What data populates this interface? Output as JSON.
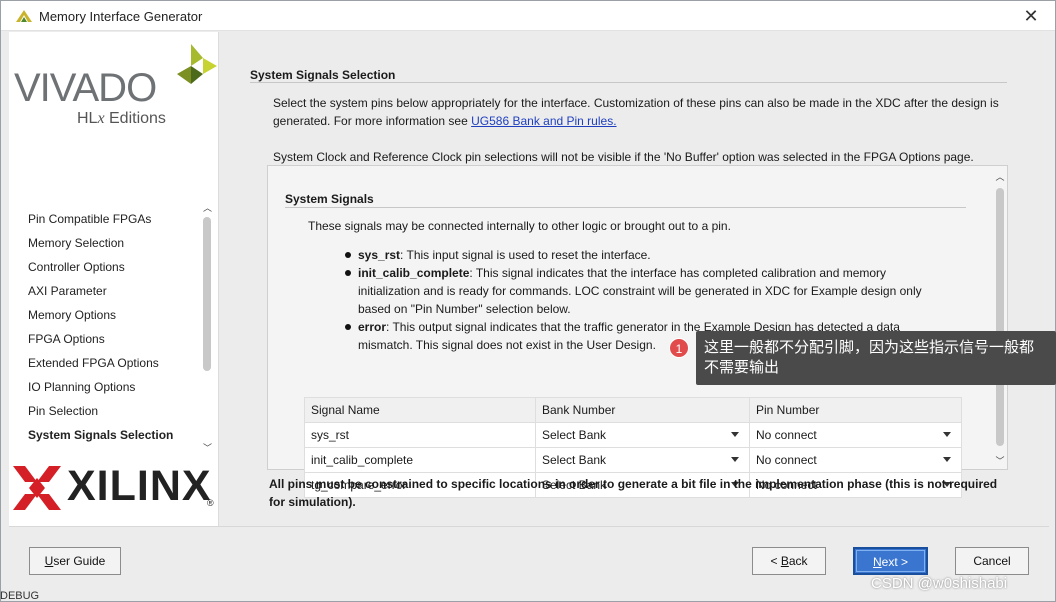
{
  "window": {
    "title": "Memory Interface Generator",
    "app_icon": "vivado-icon",
    "close_icon": "close-icon"
  },
  "branding": {
    "vivado": "VIVADO",
    "hlx_prefix": "HL",
    "hlx_x": "x",
    "hlx_suffix": " Editions",
    "xilinx": "XILINX",
    "registered": "®"
  },
  "sidebar": {
    "items": [
      {
        "label": "Pin Compatible FPGAs"
      },
      {
        "label": "Memory Selection"
      },
      {
        "label": "Controller Options"
      },
      {
        "label": "AXI Parameter"
      },
      {
        "label": "Memory Options"
      },
      {
        "label": "FPGA Options"
      },
      {
        "label": "Extended FPGA Options"
      },
      {
        "label": "IO Planning Options"
      },
      {
        "label": "Pin Selection"
      },
      {
        "label": "System Signals Selection",
        "active": true
      }
    ]
  },
  "main": {
    "section_title": "System Signals Selection",
    "intro_text": "Select the system pins below appropriately for the interface. Customization of these pins can also be made in the XDC after the design is generated. For more information see ",
    "intro_link": "UG586 Bank and Pin rules.",
    "clock_note": "System Clock and Reference Clock pin selections will not be visible if the 'No Buffer' option was selected in the FPGA Options page.",
    "signals": {
      "title": "System Signals",
      "intro": "These signals may be connected internally to other logic or brought out to a pin.",
      "bullets": [
        {
          "name": "sys_rst",
          "text": ": This input signal is used to reset the interface."
        },
        {
          "name": "init_calib_complete",
          "text": ": This signal indicates that the interface has completed calibration and memory initialization and is ready for commands. LOC constraint will be generated in XDC for Example design only based on \"Pin Number\" selection below."
        },
        {
          "name": "error",
          "text": ": This output signal indicates that the traffic generator in the Example Design has detected a data mismatch. This signal does not exist in the User Design."
        }
      ],
      "columns": [
        "Signal Name",
        "Bank Number",
        "Pin Number"
      ],
      "rows": [
        {
          "signal": "sys_rst",
          "bank": "Select Bank",
          "pin": "No connect"
        },
        {
          "signal": "init_calib_complete",
          "bank": "Select Bank",
          "pin": "No connect"
        },
        {
          "signal": "tg_compare_error",
          "bank": "Select Bank",
          "pin": "No connect"
        }
      ]
    },
    "footer_note": "All pins must be constrained to specific locations in order to generate a bit file in the implementation phase (this is not required for simulation)."
  },
  "buttons": {
    "user_guide": {
      "underline": "U",
      "rest": "ser Guide"
    },
    "back": {
      "prefix": "< ",
      "underline": "B",
      "rest": "ack"
    },
    "next": {
      "underline": "N",
      "rest": "ext >"
    },
    "cancel": "Cancel"
  },
  "annotation": {
    "marker": "1",
    "text": "这里一般都不分配引脚，因为这些指示信号一般都不需要输出"
  },
  "watermark": "CSDN @w0shishabi",
  "background_fragment": "DEBUG",
  "colors": {
    "primary_button": "#3a76d0",
    "link": "#1f3fbf",
    "tooltip_bg": "#4a4a4a",
    "marker": "#e14b4b"
  }
}
